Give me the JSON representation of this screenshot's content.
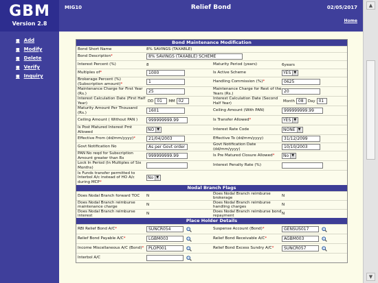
{
  "app": {
    "logo": "GBM",
    "version": "Version 2.8"
  },
  "header": {
    "code": "MIG10",
    "title": "Relief Bond",
    "date": "02/05/2017",
    "home": "Home"
  },
  "sidebar": {
    "items": [
      {
        "label": "Add"
      },
      {
        "label": "Modify"
      },
      {
        "label": "Delete"
      },
      {
        "label": "Verify"
      },
      {
        "label": "Inquiry"
      }
    ]
  },
  "sections": {
    "maint": "Bond Maintenance Modification",
    "nodal": "Nodal Branch Flags",
    "holder": "Place Holder Details"
  },
  "f": {
    "short_name_label": "Bond Short Name",
    "short_name_value": "8% SAVINGS (TAXABLE)",
    "desc_label": "Bond Description",
    "desc_value": "8% SAVINGS (TAXABLE) SCHEME",
    "interest_pct_label": "Interest Percent (%)",
    "interest_pct_value": "8",
    "maturity_period_label": "Maturity Period (years)",
    "maturity_period_value": "6years",
    "multiples_label": "Multiples of",
    "multiples_value": "1000",
    "active_label": "Is Active Scheme",
    "active_value": "YES",
    "brokerage_label": "Brokerage Percent (%) (Subscription amount)",
    "brokerage_value": "1",
    "handling_label": "Handling Commission (%)",
    "handling_value": "0625",
    "maint_first_label": "Maintenance Charge for First Year (Rs.)",
    "maint_first_value": "25",
    "maint_rest_label": "Maintenance Charge for Rest of the Years (Rs.)",
    "maint_rest_value": "20",
    "calc_first_label": "Interest Calculation Date (First Half Year)",
    "dd_label": "DD",
    "dd_value": "01",
    "mm_label": "MM",
    "mm_value": "02",
    "calc_second_label": "Interest Calculation Date (Second Half Year)",
    "month_label": "Month",
    "month_value": "08",
    "day_label": "Day",
    "day_value": "01",
    "mat_amt_label": "Maturity Amount Per Thousand (Rs.)",
    "mat_amt_value": "1601",
    "ceiling_pan_label": "Ceiling Amount (With PAN)",
    "ceiling_pan_value": "999999999.99",
    "ceiling_nopan_label": "Ceiling Amount ( Without PAN )",
    "ceiling_nopan_value": "999999999.99",
    "transfer_label": "Is Transfer Allowed",
    "transfer_value": "YES",
    "post_mat_label": "Is Post Matured Interest Pmt Allowed",
    "post_mat_value": "NO",
    "rate_code_label": "Interest Rate Code",
    "rate_code_value": "NONE",
    "eff_from_label": "Effective From (dd/mm/yyyy)",
    "eff_from_value": "21/04/2003",
    "eff_to_label": "Effective To (dd/mm/yyyy)",
    "eff_to_value": "31/12/2099",
    "govt_no_label": "Govt Notification No",
    "govt_no_value": "As per Govt order",
    "govt_date_label": "Govt Notification Date (dd/mm/yyyy)",
    "govt_date_value": "10/10/2003",
    "pan_label": "PAN No reqd for Subscription Amount greater than Rs",
    "pan_value": "999999999.99",
    "pre_mat_label": "Is Pre Matured Closure Allowed",
    "pre_mat_value": "No",
    "lockin_label": "Lock In Period (In Multiples of Six Months)",
    "lockin_value": "",
    "penalty_label": "Interest Penalty Rate (%)",
    "penalty_value": "",
    "funds_label": "Is Funds transfer permitted to Interbol A/c instead of HO A/c during MCP",
    "funds_value": "No",
    "nodal_toc_label": "Does Nodal Branch forward TOC",
    "nodal_toc_value": "N",
    "nodal_brok_label": "Does Nodal Branch reimburse brokerage",
    "nodal_brok_value": "N",
    "nodal_maint_label": "Does Nodal Branch reimburse maintenance charge",
    "nodal_maint_value": "N",
    "nodal_handle_label": "Does Nodal Branch reimburse handling charges",
    "nodal_handle_value": "N",
    "nodal_int_label": "Does Nodal Branch reimburse interest",
    "nodal_int_value": "N",
    "nodal_repay_label": "Does Nodal Branch reimburse bond repayment",
    "nodal_repay_value": "N",
    "rbi_label": "RBI Relief Bond A/C",
    "rbi_value": "SUNCR054",
    "suspense_label": "Suspense Account (Bond)",
    "suspense_value": "GENSUS017",
    "payable_label": "Relief Bond Payable A/C",
    "payable_value": "LGBM003",
    "receivable_label": "Relief Bond Receivable A/C",
    "receivable_value": "AGBM003",
    "income_label": "Income Miscellaneous A/C (Bond)",
    "income_value": "PLOP001",
    "excess_label": "Relief Bond Excess Sundry A/C",
    "excess_value": "SUNCR057",
    "interbol_label": "Interbol A/C",
    "interbol_value": ""
  }
}
